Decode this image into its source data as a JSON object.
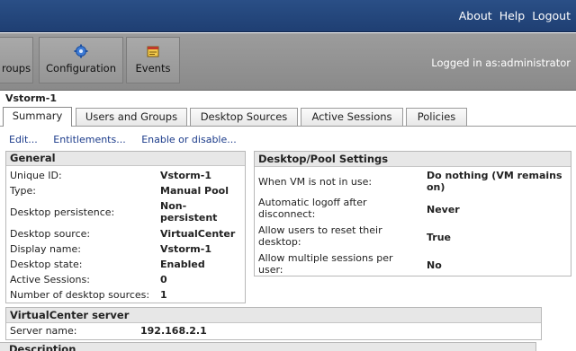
{
  "header": {
    "links": [
      "About",
      "Help",
      "Logout"
    ],
    "logged_in": "Logged in as:administrator"
  },
  "toolbar": {
    "groups_label": "roups",
    "configuration_label": "Configuration",
    "configuration_icon": "gear-icon",
    "events_label": "Events",
    "events_icon": "events-icon"
  },
  "page": {
    "title": "Vstorm-1"
  },
  "tabs": [
    "Summary",
    "Users and Groups",
    "Desktop Sources",
    "Active Sessions",
    "Policies"
  ],
  "actions": [
    "Edit...",
    "Entitlements...",
    "Enable or disable..."
  ],
  "general": {
    "title": "General",
    "rows": [
      {
        "label": "Unique ID:",
        "value": "Vstorm-1"
      },
      {
        "label": "Type:",
        "value": "Manual Pool"
      },
      {
        "label": "Desktop persistence:",
        "value_line1": "Non-",
        "value_line2": "persistent"
      },
      {
        "label": "Desktop source:",
        "value": "VirtualCenter"
      },
      {
        "label": "Display name:",
        "value": "Vstorm-1"
      },
      {
        "label": "Desktop state:",
        "value": "Enabled"
      },
      {
        "label": "Active Sessions:",
        "value": "0"
      },
      {
        "label": "Number of desktop sources:",
        "value": "1"
      }
    ]
  },
  "pool_settings": {
    "title": "Desktop/Pool Settings",
    "rows": [
      {
        "label_line1": "When VM is not in use:",
        "value_line1": "Do nothing (VM remains",
        "value_line2": "on)"
      },
      {
        "label_line1": "Automatic logoff after",
        "label_line2": "disconnect:",
        "value_line1": "Never"
      },
      {
        "label_line1": "Allow users to reset their",
        "label_line2": "desktop:",
        "value_line1": "True"
      },
      {
        "label_line1": "Allow multiple sessions per",
        "label_line2": "user:",
        "value_line1": "No"
      }
    ]
  },
  "vc_server": {
    "title": "VirtualCenter server",
    "label": "Server name:",
    "value": "192.168.2.1"
  },
  "description": {
    "title": "Description"
  }
}
